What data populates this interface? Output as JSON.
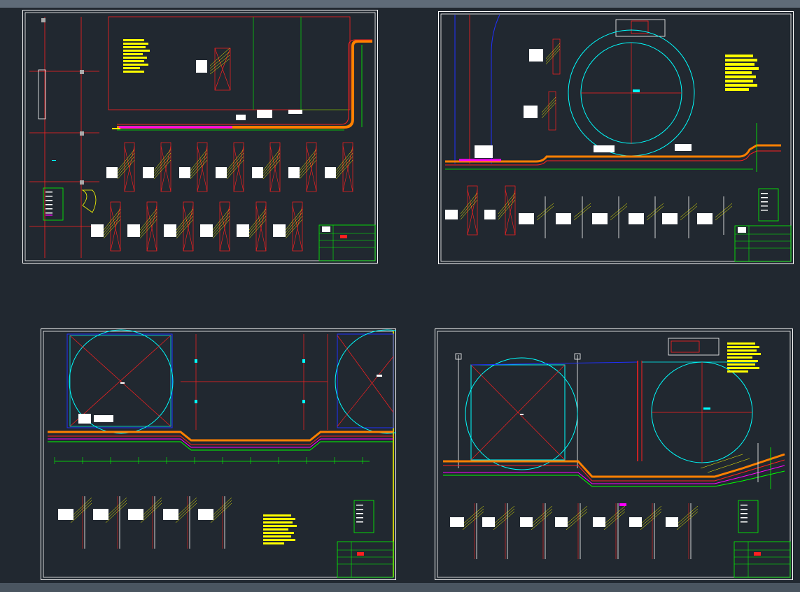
{
  "app": {
    "type": "cad-model-space",
    "sheet_count": 4
  },
  "colors": {
    "canvas": "#212830",
    "frame": "#ffffff",
    "cyan": "#00ffff",
    "red": "#ff2020",
    "yellow": "#ffff00",
    "green": "#00ff00",
    "magenta": "#ff00ff",
    "orange": "#ff8000",
    "blue": "#2030ff"
  },
  "sheets": [
    {
      "id": "top-left",
      "plan": "ramp-plan",
      "section_rows": 2
    },
    {
      "id": "top-right",
      "plan": "circular-pit-plan",
      "section_rows": 1
    },
    {
      "id": "bottom-left",
      "plan": "double-pit-plan",
      "section_rows": 1
    },
    {
      "id": "bottom-right",
      "plan": "square-and-circle-plan",
      "section_rows": 1
    }
  ],
  "icons": [
    "title-block",
    "legend-table",
    "note-block",
    "section-detail"
  ]
}
